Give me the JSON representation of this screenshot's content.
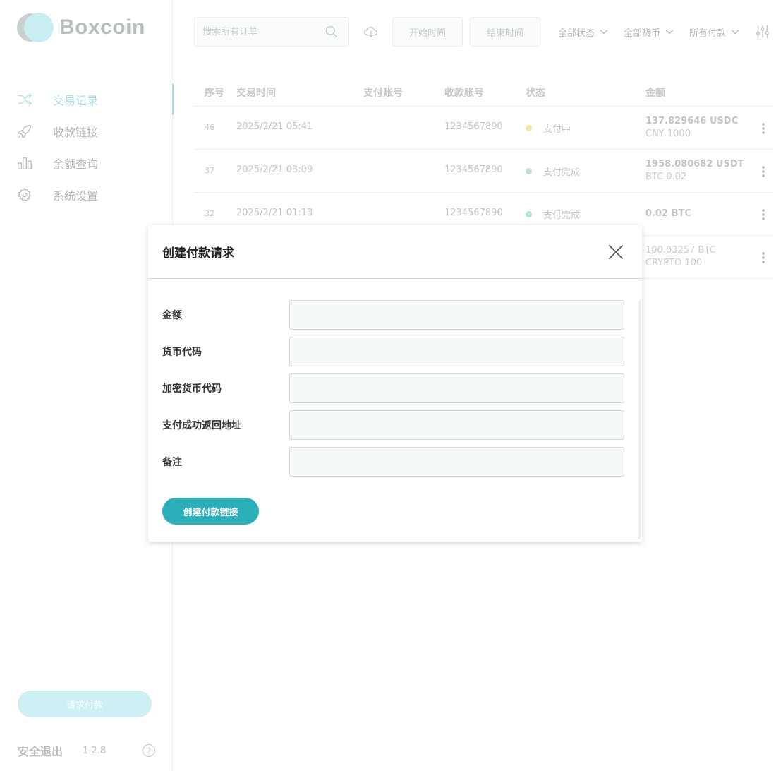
{
  "app": {
    "name": "Boxcoin",
    "version": "1.2.8"
  },
  "sidebar": {
    "items": [
      {
        "label": "交易记录",
        "icon": "shuffle-icon",
        "active": true
      },
      {
        "label": "收款链接",
        "icon": "rocket-icon",
        "active": false
      },
      {
        "label": "余额查询",
        "icon": "bar-chart-icon",
        "active": false
      },
      {
        "label": "系统设置",
        "icon": "gear-icon",
        "active": false
      }
    ],
    "request_button": "请求付款",
    "logout": "安全退出",
    "help": "?"
  },
  "toolbar": {
    "search_placeholder": "搜索所有订单",
    "start_date": "开始时间",
    "end_date": "结束时间",
    "status_filter": "全部状态",
    "currency_filter": "全部货币",
    "payment_filter": "所有付款"
  },
  "table": {
    "headers": [
      "序号",
      "交易时间",
      "支付账号",
      "收款账号",
      "状态",
      "金额"
    ],
    "rows": [
      {
        "seq": "46",
        "time": "2025/2/21 05:41",
        "payer": "",
        "payee": "1234567890",
        "status": "支付中",
        "status_color": "#f7e3a6",
        "amount": "137.829646 USDC",
        "amount_sub": "CNY 1000"
      },
      {
        "seq": "37",
        "time": "2025/2/21 03:09",
        "payer": "",
        "payee": "1234567890",
        "status": "支付完成",
        "status_color": "#b9e2d8",
        "amount": "1958.080682 USDT",
        "amount_sub": "BTC 0.02"
      },
      {
        "seq": "32",
        "time": "2025/2/21 01:13",
        "payer": "",
        "payee": "1234567890",
        "status": "支付完成",
        "status_color": "#b9e2d8",
        "amount": "0.02 BTC",
        "amount_sub": ""
      },
      {
        "seq": "",
        "time": "",
        "payer": "",
        "payee": "",
        "status": "",
        "status_color": "",
        "amount": "100.03257 BTC",
        "amount_sub": "CRYPTO 100"
      }
    ]
  },
  "modal": {
    "title": "创建付款请求",
    "fields": [
      {
        "label": "金额",
        "value": ""
      },
      {
        "label": "货币代码",
        "value": ""
      },
      {
        "label": "加密货币代码",
        "value": ""
      },
      {
        "label": "支付成功返回地址",
        "value": ""
      },
      {
        "label": "备注",
        "value": ""
      }
    ],
    "submit": "创建付款链接"
  },
  "colors": {
    "accent": "#2bb0b9",
    "accent_light": "#a8dfe4"
  }
}
